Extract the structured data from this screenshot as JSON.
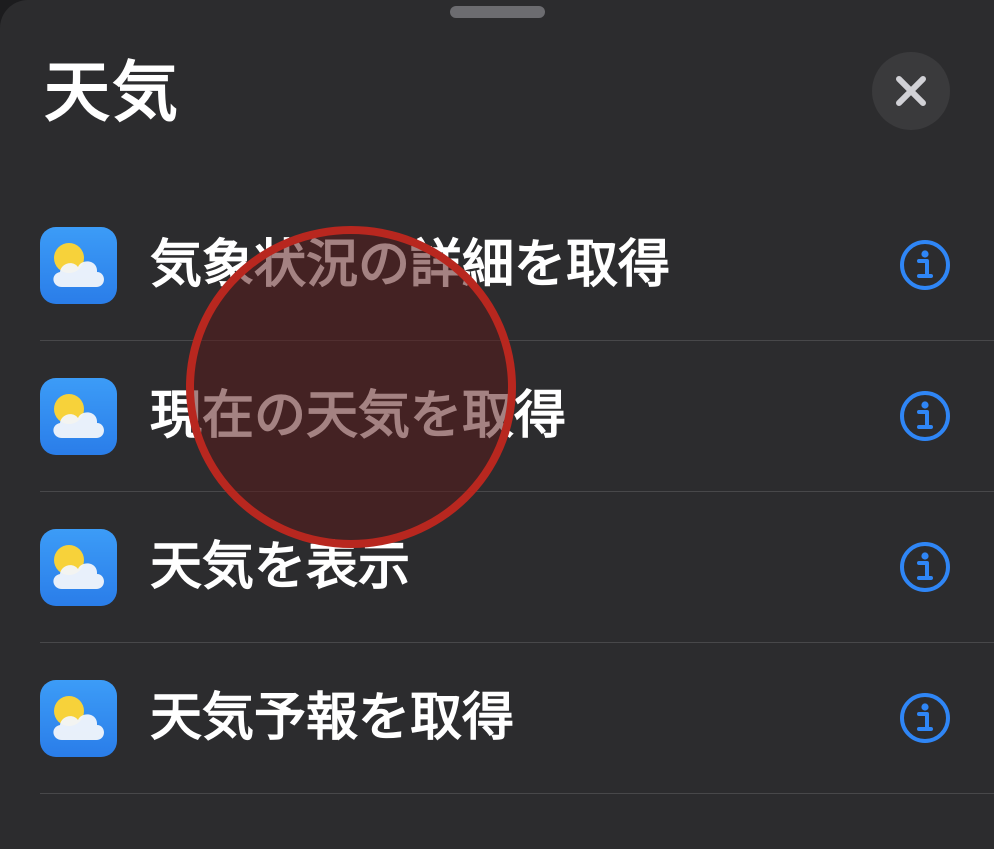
{
  "sheet": {
    "title": "天気"
  },
  "close_button": {
    "icon": "close-icon"
  },
  "actions": [
    {
      "label": "気象状況の詳細を取得",
      "icon": "weather-app-icon",
      "info_icon": "info-icon"
    },
    {
      "label": "現在の天気を取得",
      "icon": "weather-app-icon",
      "info_icon": "info-icon"
    },
    {
      "label": "天気を表示",
      "icon": "weather-app-icon",
      "info_icon": "info-icon"
    },
    {
      "label": "天気予報を取得",
      "icon": "weather-app-icon",
      "info_icon": "info-icon"
    }
  ],
  "colors": {
    "background": "#2c2c2e",
    "accent": "#2f86f6",
    "tap_indicator": "#b8271f"
  }
}
